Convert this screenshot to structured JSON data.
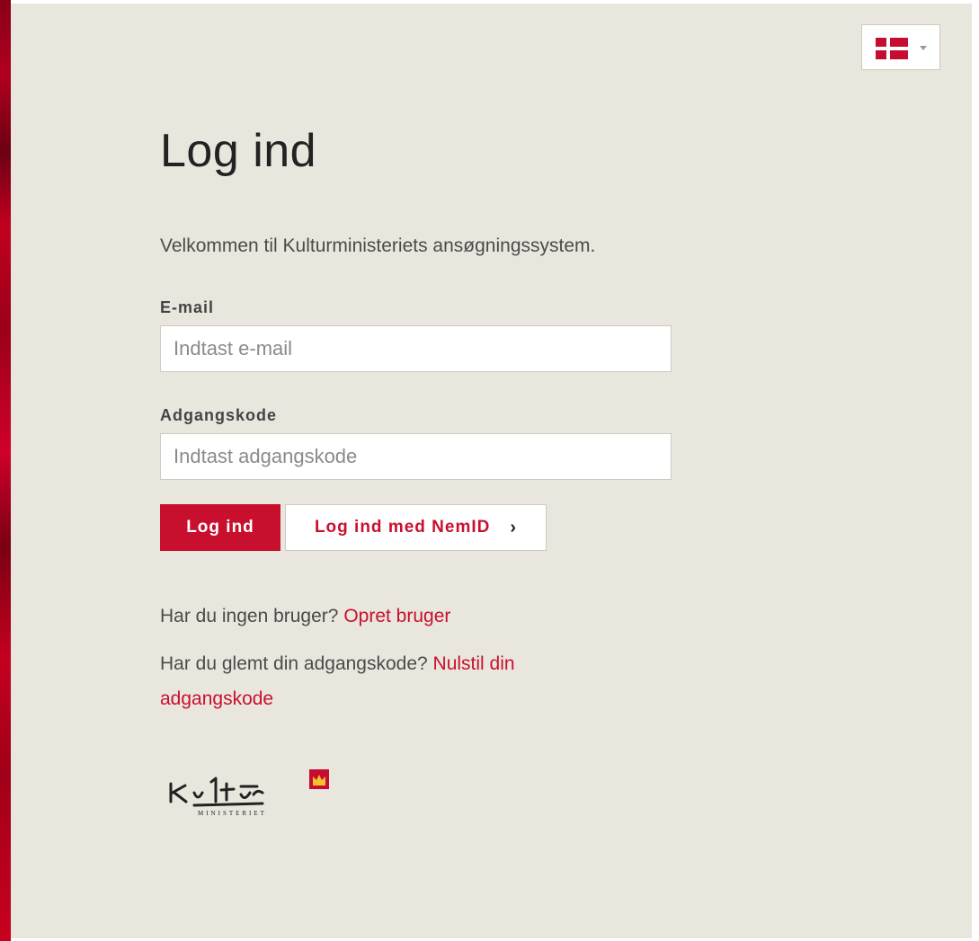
{
  "language": {
    "selected": "Dansk",
    "flag_icon": "danish-flag-icon",
    "caret_icon": "caret-down-icon"
  },
  "login": {
    "title": "Log ind",
    "intro": "Velkommen til Kulturministeriets ansøgningssystem.",
    "email_label": "E-mail",
    "email_placeholder": "Indtast e-mail",
    "email_value": "",
    "password_label": "Adgangskode",
    "password_placeholder": "Indtast adgangskode",
    "password_value": "",
    "login_button": "Log ind",
    "nemid_button": "Log ind med NemID",
    "nemid_icon": "chevron-right-icon"
  },
  "signup": {
    "prompt": "Har du ingen bruger?",
    "link": "Opret bruger"
  },
  "forgot": {
    "prompt": "Har du glemt din adgangskode?",
    "link": "Nulstil din adgangskode"
  },
  "logo": {
    "script": "Kultur",
    "subtitle": "MINISTERIET",
    "icon": "crown-icon"
  },
  "colors": {
    "accent": "#c8102e",
    "panel_background": "#e9e6de",
    "text": "#4b4b4b",
    "flag_red": "#c60c30"
  }
}
